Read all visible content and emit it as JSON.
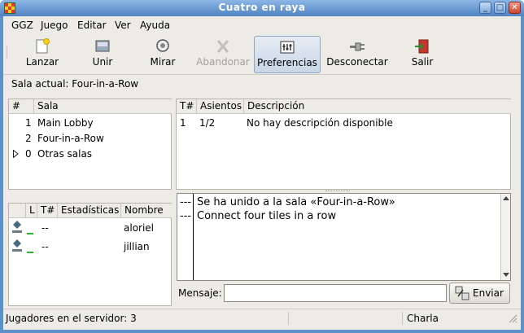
{
  "window": {
    "title": "Cuatro en raya"
  },
  "menubar": [
    "GGZ",
    "Juego",
    "Editar",
    "Ver",
    "Ayuda"
  ],
  "toolbar": {
    "launch": "Lanzar",
    "join": "Unir",
    "watch": "Mirar",
    "leave": "Abandonar",
    "prefs": "Preferencias",
    "disconnect": "Desconectar",
    "exit": "Salir"
  },
  "room_label": "Sala actual: Four-in-a-Row",
  "rooms": {
    "headers": [
      "#",
      "Sala"
    ],
    "rows": [
      {
        "num": "1",
        "name": "Main Lobby"
      },
      {
        "num": "2",
        "name": "Four-in-a-Row"
      },
      {
        "num": "0",
        "name": "Otras salas"
      }
    ]
  },
  "tables": {
    "headers": [
      "T#",
      "Asientos",
      "Descripción"
    ],
    "rows": [
      {
        "t": "1",
        "seats": "1/2",
        "desc": "No hay descripción disponible"
      }
    ]
  },
  "players": {
    "headers": [
      "L",
      "T#",
      "Estadísticas",
      "Nombre"
    ],
    "rows": [
      {
        "t": "--",
        "name": "aloriel"
      },
      {
        "t": "--",
        "name": "jillian"
      }
    ]
  },
  "chat": {
    "dash": "---",
    "lines": [
      "Se ha unido a la sala «Four-in-a-Row»",
      "Connect four tiles in a row"
    ],
    "message_label": "Mensaje:",
    "message_value": "",
    "send": "Enviar"
  },
  "status": {
    "players": "Jugadores en el servidor: 3",
    "mode": "Charla"
  }
}
